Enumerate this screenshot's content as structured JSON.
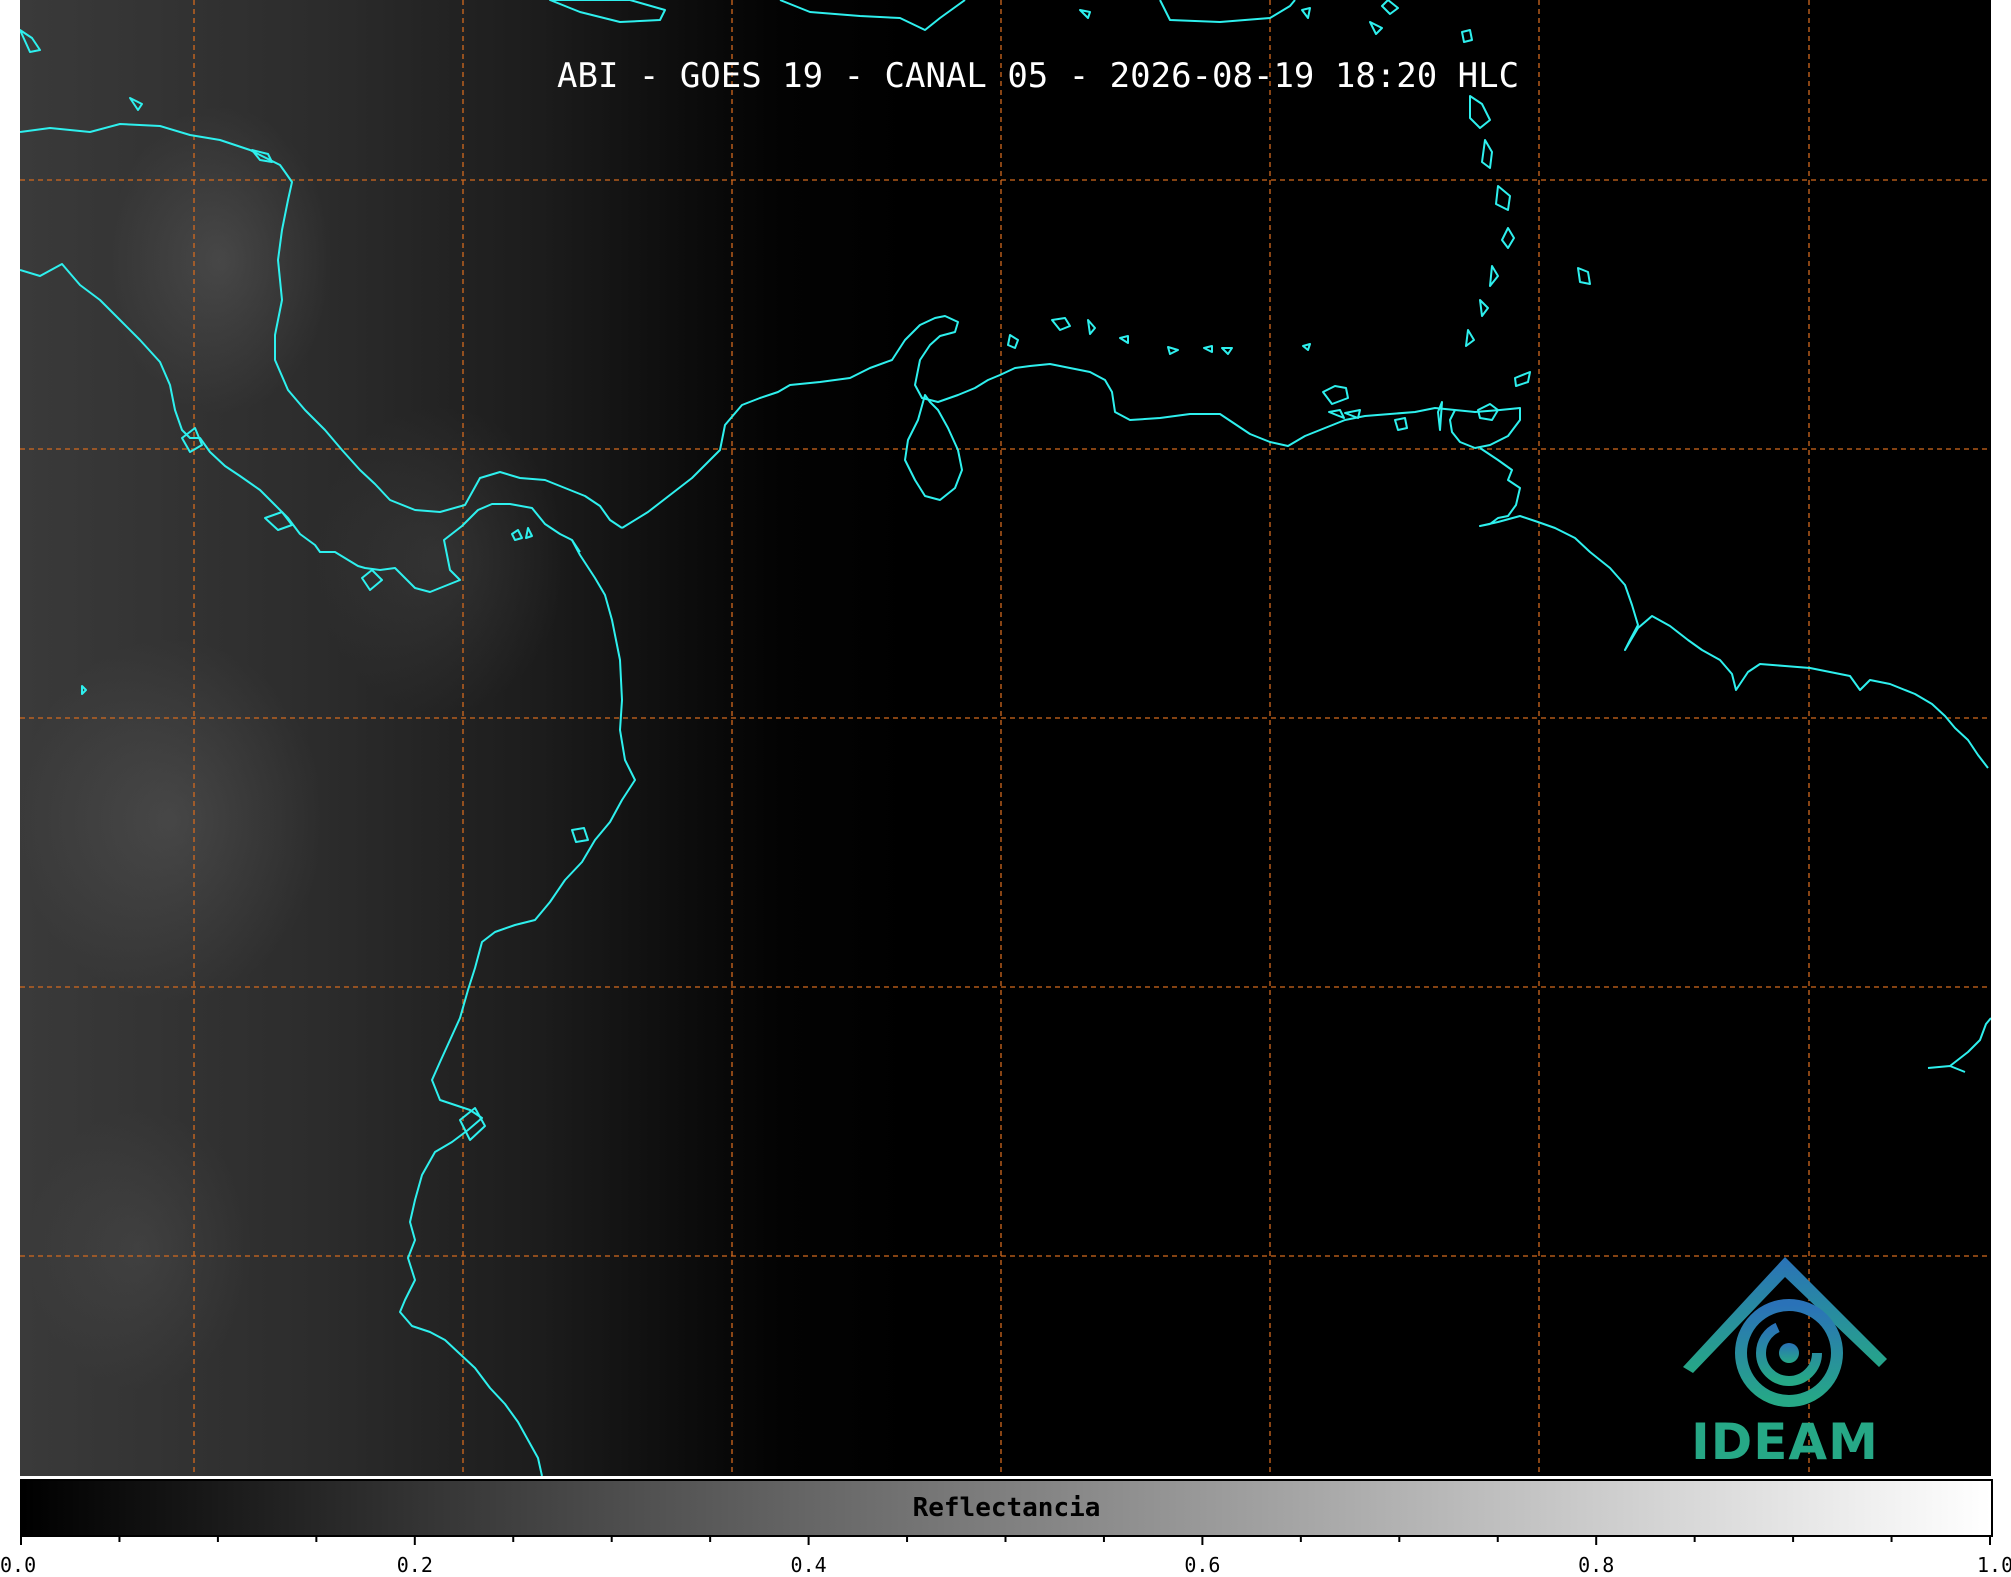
{
  "map": {
    "title": "ABI - GOES 19 - CANAL 05 - 2026-08-19 18:20 HLC",
    "colors": {
      "coastline": "#2ef0ee",
      "grid": "#d2691e",
      "background": "#000000"
    },
    "logo": {
      "text": "IDEAM",
      "icon": "ideam-logo-icon",
      "colors": [
        "#2a72b8",
        "#26a886"
      ]
    }
  },
  "colorbar": {
    "label": "Reflectancia",
    "range": [
      0.0,
      1.0
    ],
    "tick_labels": [
      "0.0",
      "0.2",
      "0.4",
      "0.6",
      "0.8",
      "1.0"
    ],
    "colors": [
      "#000000",
      "#ffffff"
    ]
  }
}
